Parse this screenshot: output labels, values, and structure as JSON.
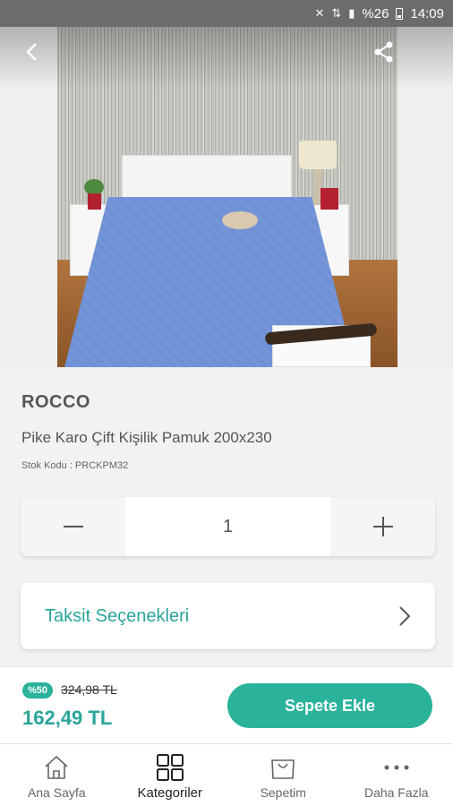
{
  "status_bar": {
    "battery_percent": "%26",
    "time": "14:09"
  },
  "product": {
    "brand": "ROCCO",
    "title": "Pike Karo Çift Kişilik Pamuk 200x230",
    "sku": "Stok Kodu : PRCKPM32"
  },
  "quantity": {
    "value": "1",
    "minus_symbol": "—",
    "plus_symbol": "+"
  },
  "installment": {
    "label": "Taksit Seçenekleri"
  },
  "price": {
    "discount_badge": "%50",
    "old_price": "324,98 TL",
    "new_price": "162,49 TL",
    "add_to_cart": "Sepete Ekle"
  },
  "bottom_nav": {
    "items": [
      {
        "label": "Ana Sayfa",
        "icon": "home-icon"
      },
      {
        "label": "Kategoriler",
        "icon": "grid-icon"
      },
      {
        "label": "Sepetim",
        "icon": "cart-icon"
      },
      {
        "label": "Daha Fazla",
        "icon": "more-icon"
      }
    ],
    "active": "Kategoriler"
  },
  "colors": {
    "accent": "#2aa59a",
    "button": "#2ab29b",
    "status_bar": "#6c6c6c"
  }
}
